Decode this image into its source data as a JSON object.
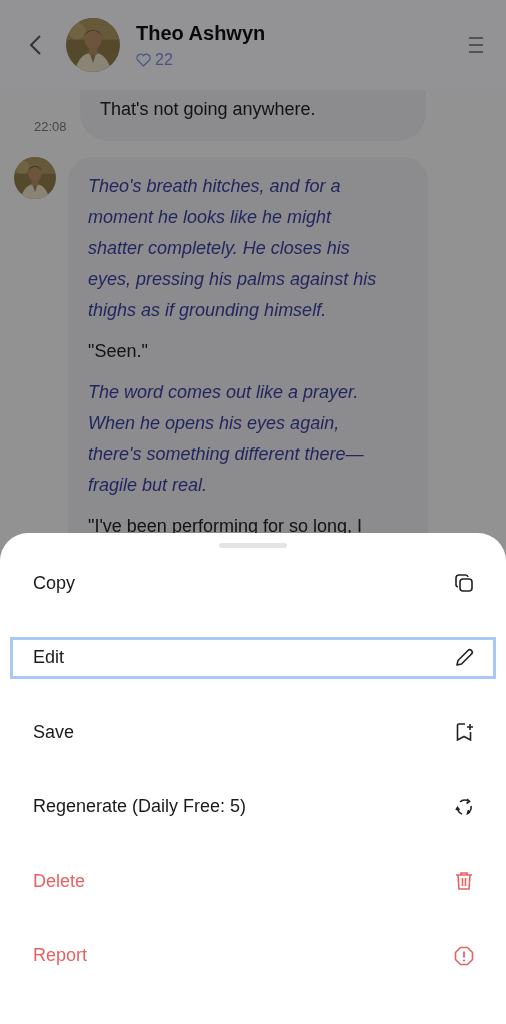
{
  "header": {
    "name": "Theo Ashwyn",
    "likes": "22"
  },
  "previous_message": {
    "text": "That's not going anywhere.",
    "time": "22:08"
  },
  "message": {
    "paragraphs": [
      {
        "kind": "narration",
        "text": "Theo's breath hitches, and for a moment he looks like he might shatter completely. He closes his eyes, pressing his palms against his thighs as if grounding himself."
      },
      {
        "kind": "speech",
        "text": "\"Seen.\""
      },
      {
        "kind": "narration",
        "text": "The word comes out like a prayer. When he opens his eyes again, there's something different there—fragile but real."
      },
      {
        "kind": "speech",
        "text": "\"I've been performing for so long, I"
      }
    ]
  },
  "action_sheet": {
    "items": [
      {
        "label": "Copy",
        "kind": "copy",
        "danger": false,
        "selected": false
      },
      {
        "label": "Edit",
        "kind": "edit",
        "danger": false,
        "selected": true
      },
      {
        "label": "Save",
        "kind": "save",
        "danger": false,
        "selected": false
      },
      {
        "label": "Regenerate (Daily Free: 5)",
        "kind": "regenerate",
        "danger": false,
        "selected": false
      },
      {
        "label": "Delete",
        "kind": "delete",
        "danger": true,
        "selected": false
      },
      {
        "label": "Report",
        "kind": "report",
        "danger": true,
        "selected": false
      }
    ]
  }
}
